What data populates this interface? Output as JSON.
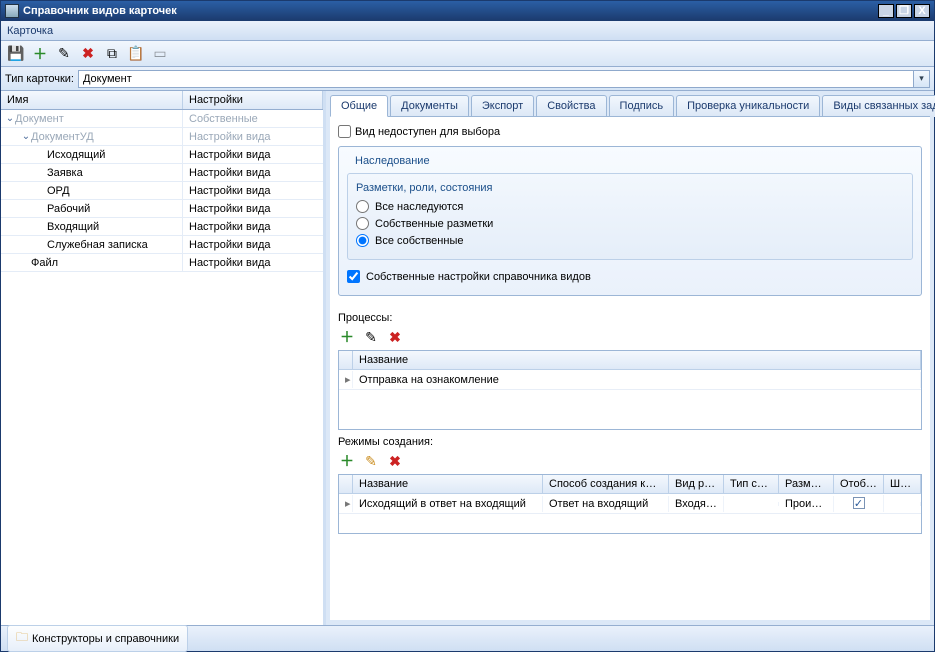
{
  "window": {
    "title": "Справочник видов карточек"
  },
  "menu": {
    "card": "Карточка"
  },
  "filter": {
    "label": "Тип карточки:",
    "value": "Документ"
  },
  "win_controls": {
    "min": "_",
    "max": "❐",
    "close": "X"
  },
  "left_grid": {
    "headers": {
      "name": "Имя",
      "settings": "Настройки"
    },
    "rows": [
      {
        "indent": 0,
        "exp": "⌄",
        "name": "Документ",
        "settings": "Собственные",
        "dim": true
      },
      {
        "indent": 1,
        "exp": "⌄",
        "name": "ДокументУД",
        "settings": "Настройки вида",
        "dim": true
      },
      {
        "indent": 2,
        "exp": "",
        "name": "Исходящий",
        "settings": "Настройки вида"
      },
      {
        "indent": 2,
        "exp": "",
        "name": "Заявка",
        "settings": "Настройки вида"
      },
      {
        "indent": 2,
        "exp": "",
        "name": "ОРД",
        "settings": "Настройки вида"
      },
      {
        "indent": 2,
        "exp": "",
        "name": "Рабочий",
        "settings": "Настройки вида"
      },
      {
        "indent": 2,
        "exp": "",
        "name": "Входящий",
        "settings": "Настройки вида"
      },
      {
        "indent": 2,
        "exp": "",
        "name": "Служебная записка",
        "settings": "Настройки вида"
      },
      {
        "indent": 1,
        "exp": "",
        "name": "Файл",
        "settings": "Настройки вида"
      }
    ]
  },
  "tabs": [
    "Общие",
    "Документы",
    "Экспорт",
    "Свойства",
    "Подпись",
    "Проверка уникальности",
    "Виды связанных заданий"
  ],
  "general": {
    "unavailable": "Вид недоступен для выбора",
    "inheritance_title": "Наследование",
    "layouts_title": "Разметки, роли, состояния",
    "radio_all_inherit": "Все наследуются",
    "radio_own_layouts": "Собственные разметки",
    "radio_all_own": "Все собственные",
    "own_dir_settings": "Собственные настройки справочника видов",
    "processes_label": "Процессы:",
    "proc_col_name": "Название",
    "proc_row1": "Отправка на ознакомление",
    "modes_label": "Режимы создания:",
    "mode_headers": {
      "name": "Название",
      "way": "Способ создания кар...",
      "parent": "Вид ро...",
      "reftype": "Тип ссы...",
      "placement": "Размещ...",
      "display": "Отобра...",
      "template": "Шабло"
    },
    "mode_row": {
      "name": "Исходящий в ответ на входящий",
      "way": "Ответ на входящий",
      "parent": "Входящий",
      "reftype": "",
      "placement": "Произв...",
      "display_checked": "✓",
      "template": ""
    }
  },
  "status": {
    "constructors": "Конструкторы и справочники"
  }
}
